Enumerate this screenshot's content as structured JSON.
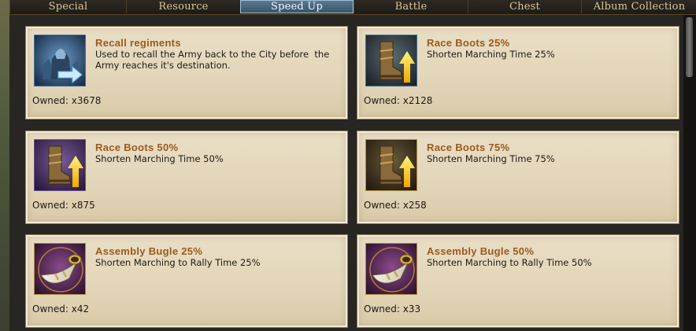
{
  "tabs": [
    {
      "label": "Special",
      "active": false
    },
    {
      "label": "Resource",
      "active": false
    },
    {
      "label": "Speed Up",
      "active": true
    },
    {
      "label": "Battle",
      "active": false
    },
    {
      "label": "Chest",
      "active": false
    },
    {
      "label": "Album Collection",
      "active": false
    }
  ],
  "items": [
    {
      "name": "Recall regiments",
      "desc": "Used to recall the Army back to the City before  the Army reaches it's destination.",
      "owned": "Owned: x3678",
      "icon": "recall-army-icon",
      "frame_color": "#3f6f9a"
    },
    {
      "name": "Race Boots 25%",
      "desc": "Shorten Marching Time 25%",
      "owned": "Owned: x2128",
      "icon": "race-boots-icon",
      "frame_color": "#3f6f9a"
    },
    {
      "name": "Race Boots 50%",
      "desc": "Shorten Marching Time 50%",
      "owned": "Owned: x875",
      "icon": "race-boots-icon",
      "frame_color": "#6a4d8f"
    },
    {
      "name": "Race Boots 75%",
      "desc": "Shorten Marching Time 75%",
      "owned": "Owned: x258",
      "icon": "race-boots-icon",
      "frame_color": "#b08a3a"
    },
    {
      "name": "Assembly Bugle 25%",
      "desc": "Shorten Marching to Rally Time 25%",
      "owned": "Owned: x42",
      "icon": "assembly-bugle-icon",
      "frame_color": "#b08a3a"
    },
    {
      "name": "Assembly Bugle 50%",
      "desc": "Shorten Marching to Rally Time 50%",
      "owned": "Owned: x33",
      "icon": "assembly-bugle-icon",
      "frame_color": "#b08a3a"
    }
  ]
}
